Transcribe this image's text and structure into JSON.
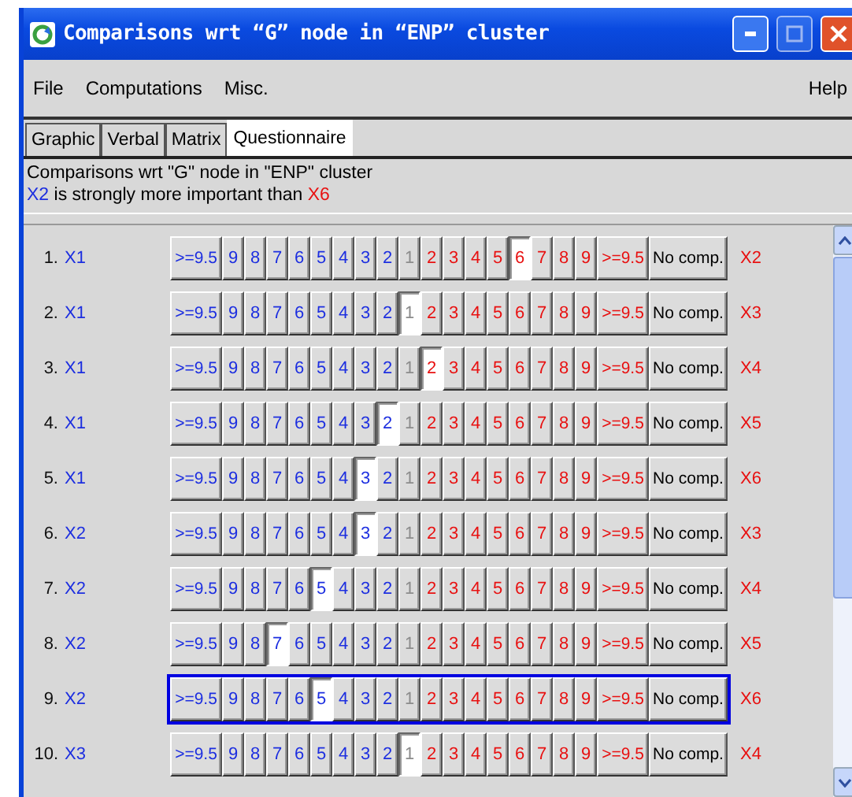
{
  "window": {
    "title": "Comparisons wrt “G” node in “ENP” cluster"
  },
  "menu": [
    "File",
    "Computations",
    "Misc."
  ],
  "help": "Help",
  "tabs": [
    {
      "label": "Graphic",
      "selected": false
    },
    {
      "label": "Verbal",
      "selected": false
    },
    {
      "label": "Matrix",
      "selected": false
    },
    {
      "label": "Questionnaire",
      "selected": true
    }
  ],
  "info": {
    "heading": "Comparisons wrt \"G\" node in \"ENP\" cluster",
    "left": "X2",
    "phrase": "is strongly more important than",
    "right": "X6"
  },
  "rows": [
    {
      "number": "1.",
      "left": "X1",
      "right": "X2",
      "focused": false,
      "buttons": [
        {
          "label": ">=9.5",
          "kind": "left",
          "selected": false
        },
        {
          "label": "9",
          "kind": "left",
          "selected": false
        },
        {
          "label": "8",
          "kind": "left",
          "selected": false
        },
        {
          "label": "7",
          "kind": "left",
          "selected": false
        },
        {
          "label": "6",
          "kind": "left",
          "selected": false
        },
        {
          "label": "5",
          "kind": "left",
          "selected": false
        },
        {
          "label": "4",
          "kind": "left",
          "selected": false
        },
        {
          "label": "3",
          "kind": "left",
          "selected": false
        },
        {
          "label": "2",
          "kind": "left",
          "selected": false
        },
        {
          "label": "1",
          "kind": "center",
          "selected": false
        },
        {
          "label": "2",
          "kind": "right",
          "selected": false
        },
        {
          "label": "3",
          "kind": "right",
          "selected": false
        },
        {
          "label": "4",
          "kind": "right",
          "selected": false
        },
        {
          "label": "5",
          "kind": "right",
          "selected": false
        },
        {
          "label": "6",
          "kind": "right",
          "selected": true
        },
        {
          "label": "7",
          "kind": "right",
          "selected": false
        },
        {
          "label": "8",
          "kind": "right",
          "selected": false
        },
        {
          "label": "9",
          "kind": "right",
          "selected": false
        },
        {
          "label": ">=9.5",
          "kind": "right",
          "selected": false
        },
        {
          "label": "No comp.",
          "kind": "none",
          "selected": false
        }
      ]
    },
    {
      "number": "2.",
      "left": "X1",
      "right": "X3",
      "focused": false,
      "buttons": [
        {
          "label": ">=9.5",
          "kind": "left",
          "selected": false
        },
        {
          "label": "9",
          "kind": "left",
          "selected": false
        },
        {
          "label": "8",
          "kind": "left",
          "selected": false
        },
        {
          "label": "7",
          "kind": "left",
          "selected": false
        },
        {
          "label": "6",
          "kind": "left",
          "selected": false
        },
        {
          "label": "5",
          "kind": "left",
          "selected": false
        },
        {
          "label": "4",
          "kind": "left",
          "selected": false
        },
        {
          "label": "3",
          "kind": "left",
          "selected": false
        },
        {
          "label": "2",
          "kind": "left",
          "selected": false
        },
        {
          "label": "1",
          "kind": "center",
          "selected": true
        },
        {
          "label": "2",
          "kind": "right",
          "selected": false
        },
        {
          "label": "3",
          "kind": "right",
          "selected": false
        },
        {
          "label": "4",
          "kind": "right",
          "selected": false
        },
        {
          "label": "5",
          "kind": "right",
          "selected": false
        },
        {
          "label": "6",
          "kind": "right",
          "selected": false
        },
        {
          "label": "7",
          "kind": "right",
          "selected": false
        },
        {
          "label": "8",
          "kind": "right",
          "selected": false
        },
        {
          "label": "9",
          "kind": "right",
          "selected": false
        },
        {
          "label": ">=9.5",
          "kind": "right",
          "selected": false
        },
        {
          "label": "No comp.",
          "kind": "none",
          "selected": false
        }
      ]
    },
    {
      "number": "3.",
      "left": "X1",
      "right": "X4",
      "focused": false,
      "buttons": [
        {
          "label": ">=9.5",
          "kind": "left",
          "selected": false
        },
        {
          "label": "9",
          "kind": "left",
          "selected": false
        },
        {
          "label": "8",
          "kind": "left",
          "selected": false
        },
        {
          "label": "7",
          "kind": "left",
          "selected": false
        },
        {
          "label": "6",
          "kind": "left",
          "selected": false
        },
        {
          "label": "5",
          "kind": "left",
          "selected": false
        },
        {
          "label": "4",
          "kind": "left",
          "selected": false
        },
        {
          "label": "3",
          "kind": "left",
          "selected": false
        },
        {
          "label": "2",
          "kind": "left",
          "selected": false
        },
        {
          "label": "1",
          "kind": "center",
          "selected": false
        },
        {
          "label": "2",
          "kind": "right",
          "selected": true
        },
        {
          "label": "3",
          "kind": "right",
          "selected": false
        },
        {
          "label": "4",
          "kind": "right",
          "selected": false
        },
        {
          "label": "5",
          "kind": "right",
          "selected": false
        },
        {
          "label": "6",
          "kind": "right",
          "selected": false
        },
        {
          "label": "7",
          "kind": "right",
          "selected": false
        },
        {
          "label": "8",
          "kind": "right",
          "selected": false
        },
        {
          "label": "9",
          "kind": "right",
          "selected": false
        },
        {
          "label": ">=9.5",
          "kind": "right",
          "selected": false
        },
        {
          "label": "No comp.",
          "kind": "none",
          "selected": false
        }
      ]
    },
    {
      "number": "4.",
      "left": "X1",
      "right": "X5",
      "focused": false,
      "buttons": [
        {
          "label": ">=9.5",
          "kind": "left",
          "selected": false
        },
        {
          "label": "9",
          "kind": "left",
          "selected": false
        },
        {
          "label": "8",
          "kind": "left",
          "selected": false
        },
        {
          "label": "7",
          "kind": "left",
          "selected": false
        },
        {
          "label": "6",
          "kind": "left",
          "selected": false
        },
        {
          "label": "5",
          "kind": "left",
          "selected": false
        },
        {
          "label": "4",
          "kind": "left",
          "selected": false
        },
        {
          "label": "3",
          "kind": "left",
          "selected": false
        },
        {
          "label": "2",
          "kind": "left",
          "selected": true
        },
        {
          "label": "1",
          "kind": "center",
          "selected": false
        },
        {
          "label": "2",
          "kind": "right",
          "selected": false
        },
        {
          "label": "3",
          "kind": "right",
          "selected": false
        },
        {
          "label": "4",
          "kind": "right",
          "selected": false
        },
        {
          "label": "5",
          "kind": "right",
          "selected": false
        },
        {
          "label": "6",
          "kind": "right",
          "selected": false
        },
        {
          "label": "7",
          "kind": "right",
          "selected": false
        },
        {
          "label": "8",
          "kind": "right",
          "selected": false
        },
        {
          "label": "9",
          "kind": "right",
          "selected": false
        },
        {
          "label": ">=9.5",
          "kind": "right",
          "selected": false
        },
        {
          "label": "No comp.",
          "kind": "none",
          "selected": false
        }
      ]
    },
    {
      "number": "5.",
      "left": "X1",
      "right": "X6",
      "focused": false,
      "buttons": [
        {
          "label": ">=9.5",
          "kind": "left",
          "selected": false
        },
        {
          "label": "9",
          "kind": "left",
          "selected": false
        },
        {
          "label": "8",
          "kind": "left",
          "selected": false
        },
        {
          "label": "7",
          "kind": "left",
          "selected": false
        },
        {
          "label": "6",
          "kind": "left",
          "selected": false
        },
        {
          "label": "5",
          "kind": "left",
          "selected": false
        },
        {
          "label": "4",
          "kind": "left",
          "selected": false
        },
        {
          "label": "3",
          "kind": "left",
          "selected": true
        },
        {
          "label": "2",
          "kind": "left",
          "selected": false
        },
        {
          "label": "1",
          "kind": "center",
          "selected": false
        },
        {
          "label": "2",
          "kind": "right",
          "selected": false
        },
        {
          "label": "3",
          "kind": "right",
          "selected": false
        },
        {
          "label": "4",
          "kind": "right",
          "selected": false
        },
        {
          "label": "5",
          "kind": "right",
          "selected": false
        },
        {
          "label": "6",
          "kind": "right",
          "selected": false
        },
        {
          "label": "7",
          "kind": "right",
          "selected": false
        },
        {
          "label": "8",
          "kind": "right",
          "selected": false
        },
        {
          "label": "9",
          "kind": "right",
          "selected": false
        },
        {
          "label": ">=9.5",
          "kind": "right",
          "selected": false
        },
        {
          "label": "No comp.",
          "kind": "none",
          "selected": false
        }
      ]
    },
    {
      "number": "6.",
      "left": "X2",
      "right": "X3",
      "focused": false,
      "buttons": [
        {
          "label": ">=9.5",
          "kind": "left",
          "selected": false
        },
        {
          "label": "9",
          "kind": "left",
          "selected": false
        },
        {
          "label": "8",
          "kind": "left",
          "selected": false
        },
        {
          "label": "7",
          "kind": "left",
          "selected": false
        },
        {
          "label": "6",
          "kind": "left",
          "selected": false
        },
        {
          "label": "5",
          "kind": "left",
          "selected": false
        },
        {
          "label": "4",
          "kind": "left",
          "selected": false
        },
        {
          "label": "3",
          "kind": "left",
          "selected": true
        },
        {
          "label": "2",
          "kind": "left",
          "selected": false
        },
        {
          "label": "1",
          "kind": "center",
          "selected": false
        },
        {
          "label": "2",
          "kind": "right",
          "selected": false
        },
        {
          "label": "3",
          "kind": "right",
          "selected": false
        },
        {
          "label": "4",
          "kind": "right",
          "selected": false
        },
        {
          "label": "5",
          "kind": "right",
          "selected": false
        },
        {
          "label": "6",
          "kind": "right",
          "selected": false
        },
        {
          "label": "7",
          "kind": "right",
          "selected": false
        },
        {
          "label": "8",
          "kind": "right",
          "selected": false
        },
        {
          "label": "9",
          "kind": "right",
          "selected": false
        },
        {
          "label": ">=9.5",
          "kind": "right",
          "selected": false
        },
        {
          "label": "No comp.",
          "kind": "none",
          "selected": false
        }
      ]
    },
    {
      "number": "7.",
      "left": "X2",
      "right": "X4",
      "focused": false,
      "buttons": [
        {
          "label": ">=9.5",
          "kind": "left",
          "selected": false
        },
        {
          "label": "9",
          "kind": "left",
          "selected": false
        },
        {
          "label": "8",
          "kind": "left",
          "selected": false
        },
        {
          "label": "7",
          "kind": "left",
          "selected": false
        },
        {
          "label": "6",
          "kind": "left",
          "selected": false
        },
        {
          "label": "5",
          "kind": "left",
          "selected": true
        },
        {
          "label": "4",
          "kind": "left",
          "selected": false
        },
        {
          "label": "3",
          "kind": "left",
          "selected": false
        },
        {
          "label": "2",
          "kind": "left",
          "selected": false
        },
        {
          "label": "1",
          "kind": "center",
          "selected": false
        },
        {
          "label": "2",
          "kind": "right",
          "selected": false
        },
        {
          "label": "3",
          "kind": "right",
          "selected": false
        },
        {
          "label": "4",
          "kind": "right",
          "selected": false
        },
        {
          "label": "5",
          "kind": "right",
          "selected": false
        },
        {
          "label": "6",
          "kind": "right",
          "selected": false
        },
        {
          "label": "7",
          "kind": "right",
          "selected": false
        },
        {
          "label": "8",
          "kind": "right",
          "selected": false
        },
        {
          "label": "9",
          "kind": "right",
          "selected": false
        },
        {
          "label": ">=9.5",
          "kind": "right",
          "selected": false
        },
        {
          "label": "No comp.",
          "kind": "none",
          "selected": false
        }
      ]
    },
    {
      "number": "8.",
      "left": "X2",
      "right": "X5",
      "focused": false,
      "buttons": [
        {
          "label": ">=9.5",
          "kind": "left",
          "selected": false
        },
        {
          "label": "9",
          "kind": "left",
          "selected": false
        },
        {
          "label": "8",
          "kind": "left",
          "selected": false
        },
        {
          "label": "7",
          "kind": "left",
          "selected": true
        },
        {
          "label": "6",
          "kind": "left",
          "selected": false
        },
        {
          "label": "5",
          "kind": "left",
          "selected": false
        },
        {
          "label": "4",
          "kind": "left",
          "selected": false
        },
        {
          "label": "3",
          "kind": "left",
          "selected": false
        },
        {
          "label": "2",
          "kind": "left",
          "selected": false
        },
        {
          "label": "1",
          "kind": "center",
          "selected": false
        },
        {
          "label": "2",
          "kind": "right",
          "selected": false
        },
        {
          "label": "3",
          "kind": "right",
          "selected": false
        },
        {
          "label": "4",
          "kind": "right",
          "selected": false
        },
        {
          "label": "5",
          "kind": "right",
          "selected": false
        },
        {
          "label": "6",
          "kind": "right",
          "selected": false
        },
        {
          "label": "7",
          "kind": "right",
          "selected": false
        },
        {
          "label": "8",
          "kind": "right",
          "selected": false
        },
        {
          "label": "9",
          "kind": "right",
          "selected": false
        },
        {
          "label": ">=9.5",
          "kind": "right",
          "selected": false
        },
        {
          "label": "No comp.",
          "kind": "none",
          "selected": false
        }
      ]
    },
    {
      "number": "9.",
      "left": "X2",
      "right": "X6",
      "focused": true,
      "buttons": [
        {
          "label": ">=9.5",
          "kind": "left",
          "selected": false
        },
        {
          "label": "9",
          "kind": "left",
          "selected": false
        },
        {
          "label": "8",
          "kind": "left",
          "selected": false
        },
        {
          "label": "7",
          "kind": "left",
          "selected": false
        },
        {
          "label": "6",
          "kind": "left",
          "selected": false
        },
        {
          "label": "5",
          "kind": "left",
          "selected": true
        },
        {
          "label": "4",
          "kind": "left",
          "selected": false
        },
        {
          "label": "3",
          "kind": "left",
          "selected": false
        },
        {
          "label": "2",
          "kind": "left",
          "selected": false
        },
        {
          "label": "1",
          "kind": "center",
          "selected": false
        },
        {
          "label": "2",
          "kind": "right",
          "selected": false
        },
        {
          "label": "3",
          "kind": "right",
          "selected": false
        },
        {
          "label": "4",
          "kind": "right",
          "selected": false
        },
        {
          "label": "5",
          "kind": "right",
          "selected": false
        },
        {
          "label": "6",
          "kind": "right",
          "selected": false
        },
        {
          "label": "7",
          "kind": "right",
          "selected": false
        },
        {
          "label": "8",
          "kind": "right",
          "selected": false
        },
        {
          "label": "9",
          "kind": "right",
          "selected": false
        },
        {
          "label": ">=9.5",
          "kind": "right",
          "selected": false
        },
        {
          "label": "No comp.",
          "kind": "none",
          "selected": false
        }
      ]
    },
    {
      "number": "10.",
      "left": "X3",
      "right": "X4",
      "focused": false,
      "buttons": [
        {
          "label": ">=9.5",
          "kind": "left",
          "selected": false
        },
        {
          "label": "9",
          "kind": "left",
          "selected": false
        },
        {
          "label": "8",
          "kind": "left",
          "selected": false
        },
        {
          "label": "7",
          "kind": "left",
          "selected": false
        },
        {
          "label": "6",
          "kind": "left",
          "selected": false
        },
        {
          "label": "5",
          "kind": "left",
          "selected": false
        },
        {
          "label": "4",
          "kind": "left",
          "selected": false
        },
        {
          "label": "3",
          "kind": "left",
          "selected": false
        },
        {
          "label": "2",
          "kind": "left",
          "selected": false
        },
        {
          "label": "1",
          "kind": "center",
          "selected": true
        },
        {
          "label": "2",
          "kind": "right",
          "selected": false
        },
        {
          "label": "3",
          "kind": "right",
          "selected": false
        },
        {
          "label": "4",
          "kind": "right",
          "selected": false
        },
        {
          "label": "5",
          "kind": "right",
          "selected": false
        },
        {
          "label": "6",
          "kind": "right",
          "selected": false
        },
        {
          "label": "7",
          "kind": "right",
          "selected": false
        },
        {
          "label": "8",
          "kind": "right",
          "selected": false
        },
        {
          "label": "9",
          "kind": "right",
          "selected": false
        },
        {
          "label": ">=9.5",
          "kind": "right",
          "selected": false
        },
        {
          "label": "No comp.",
          "kind": "none",
          "selected": false
        }
      ]
    }
  ]
}
